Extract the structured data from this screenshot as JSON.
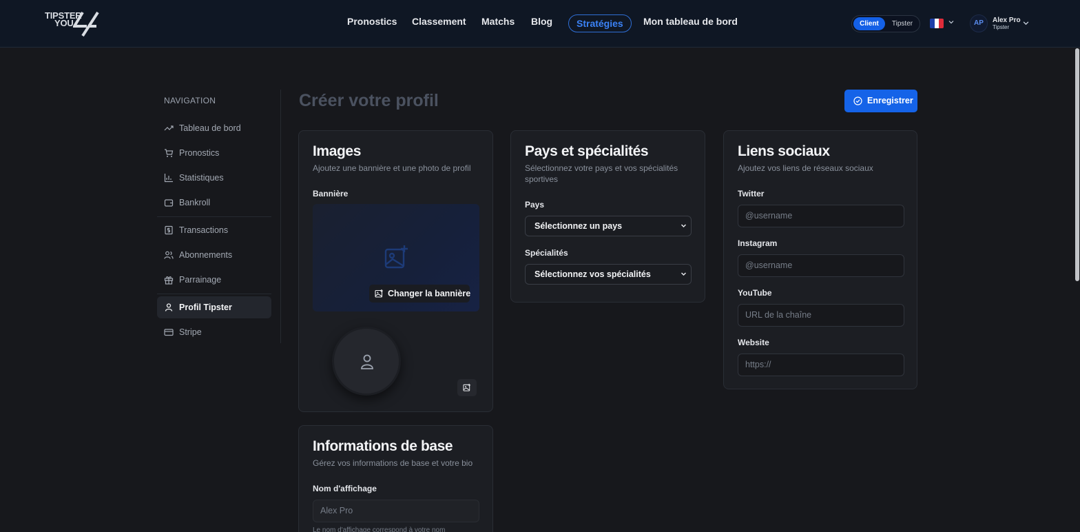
{
  "brand": {
    "line1": "TIPSTER",
    "line2": "YOU"
  },
  "nav": {
    "links": [
      "Pronostics",
      "Classement",
      "Matchs",
      "Blog",
      "Stratégies",
      "Mon tableau de bord"
    ]
  },
  "mode_toggle": {
    "client": "Client",
    "tipster": "Tipster",
    "selected": "Client"
  },
  "language": {
    "flag": "fr-flag"
  },
  "user": {
    "initials": "AP",
    "name": "Alex Pro",
    "role": "Tipster"
  },
  "sidebar": {
    "heading": "NAVIGATION",
    "items": [
      {
        "label": "Tableau de bord",
        "icon": "trending-up-icon"
      },
      {
        "label": "Pronostics",
        "icon": "cart-icon"
      },
      {
        "label": "Statistiques",
        "icon": "bar-chart-icon"
      },
      {
        "label": "Bankroll",
        "icon": "wallet-icon"
      },
      {
        "label": "Transactions",
        "icon": "receipt-icon"
      },
      {
        "label": "Abonnements",
        "icon": "users-icon"
      },
      {
        "label": "Parrainage",
        "icon": "gift-icon"
      },
      {
        "label": "Profil Tipster",
        "icon": "user-icon",
        "active": true
      },
      {
        "label": "Stripe",
        "icon": "card-icon"
      }
    ]
  },
  "page": {
    "title": "Créer votre profil",
    "save_label": "Enregistrer"
  },
  "images_card": {
    "title": "Images",
    "subtitle": "Ajoutez une bannière et une photo de profil",
    "banner_label": "Bannière",
    "change_banner": "Changer la bannière"
  },
  "country_card": {
    "title": "Pays et spécialités",
    "subtitle": "Sélectionnez votre pays et vos spécialités sportives",
    "country_label": "Pays",
    "country_value": "Sélectionnez un pays",
    "specialties_label": "Spécialités",
    "specialties_value": "Sélectionnez vos spécialités"
  },
  "social_card": {
    "title": "Liens sociaux",
    "subtitle": "Ajoutez vos liens de réseaux sociaux",
    "fields": [
      {
        "label": "Twitter",
        "placeholder": "@username"
      },
      {
        "label": "Instagram",
        "placeholder": "@username"
      },
      {
        "label": "YouTube",
        "placeholder": "URL de la chaîne"
      },
      {
        "label": "Website",
        "placeholder": "https://"
      }
    ]
  },
  "basic_card": {
    "title": "Informations de base",
    "subtitle": "Gérez vos informations de base et votre bio",
    "display_name_label": "Nom d'affichage",
    "display_name_value": "Alex Pro",
    "display_name_help": "Le nom d'affichage correspond à votre nom"
  },
  "colors": {
    "accent": "#1563e8",
    "background": "#17181c",
    "card": "#1c1e23",
    "topbar": "#0f1724"
  }
}
